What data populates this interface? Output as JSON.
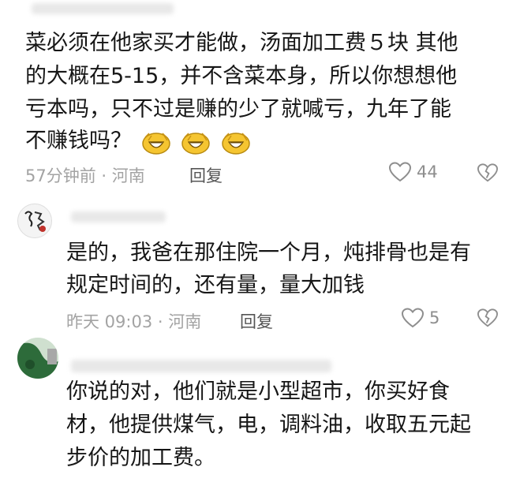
{
  "comments": [
    {
      "lines": [
        "菜必须在他家买才能做，汤面加工费５块 其他",
        "的大概在5-15，并不含菜本身，所以你想想他",
        "亏本吗，只不过是赚的少了就喊亏，九年了能",
        "不赚钱吗？"
      ],
      "meta": "57分钟前 · 河南",
      "reply": "回复",
      "likes": "44",
      "emoji_count": 3
    },
    {
      "lines": [
        "是的，我爸在那住院一个月，炖排骨也是有",
        "规定时间的，还有量，量大加钱"
      ],
      "meta": "昨天 09:03 · 河南",
      "reply": "回复",
      "likes": "5"
    },
    {
      "lines": [
        "你说的对，他们就是小型超市，你买好食",
        "材，他提供煤气，电，调料油，收取五元起",
        "步价的加工费。"
      ]
    }
  ],
  "icons": {
    "like": "heart-outline-icon",
    "dislike": "broken-heart-icon",
    "emoji": "pill-laugh-emoji"
  },
  "colors": {
    "text": "#161616",
    "meta": "#a3a3a3",
    "reply": "#555555"
  }
}
